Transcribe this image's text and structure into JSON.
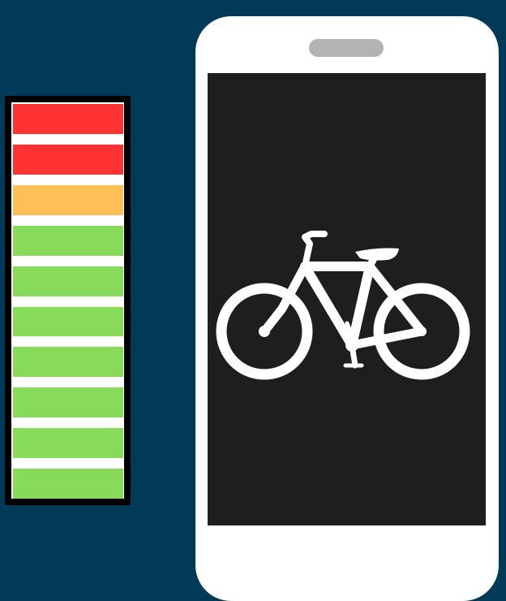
{
  "meter": {
    "segments": [
      {
        "color": "#ff3333",
        "level": "red"
      },
      {
        "color": "#ff3333",
        "level": "red"
      },
      {
        "color": "#ffbf57",
        "level": "orange"
      },
      {
        "color": "#87da5a",
        "level": "green"
      },
      {
        "color": "#87da5a",
        "level": "green"
      },
      {
        "color": "#87da5a",
        "level": "green"
      },
      {
        "color": "#87da5a",
        "level": "green"
      },
      {
        "color": "#87da5a",
        "level": "green"
      },
      {
        "color": "#87da5a",
        "level": "green"
      },
      {
        "color": "#87da5a",
        "level": "green"
      }
    ],
    "frame_color": "#000000"
  },
  "phone": {
    "body_color": "#ffffff",
    "speaker_color": "#b3b3b3",
    "screen_color": "#1e1e1e",
    "screen_icon": "bicycle-icon",
    "icon_color": "#ffffff"
  },
  "background_color": "#013a58"
}
